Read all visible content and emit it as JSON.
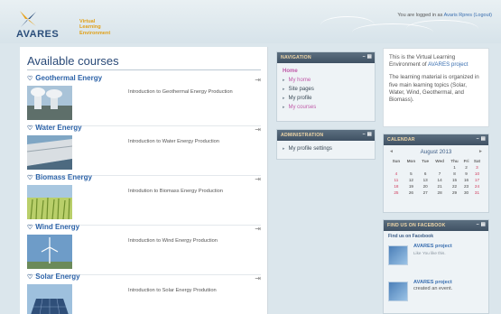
{
  "header": {
    "logo_word": "AVARES",
    "logo_tagline_1": "Virtual",
    "logo_tagline_2": "Learning",
    "logo_tagline_3": "Environment",
    "login_prefix": "You are logged in as",
    "login_user": "Avaris Rpres",
    "login_logout": "(Logout)"
  },
  "main": {
    "title": "Available courses",
    "courses": [
      {
        "name": "Geothermal Energy",
        "description": "Introduction to Geothermal Energy Production"
      },
      {
        "name": "Water Energy",
        "description": "Introduction to Water Energy Production"
      },
      {
        "name": "Biomass Energy",
        "description": "Introdution to Biomass Energy Production"
      },
      {
        "name": "Wind Energy",
        "description": "Introduction to Wind Energy Production"
      },
      {
        "name": "Solar Energy",
        "description": "Introduction to Solar Energy Produtiion"
      }
    ]
  },
  "navigation": {
    "title": "NAVIGATION",
    "home": "Home",
    "items": [
      "My home",
      "Site pages",
      "My profile",
      "My courses"
    ]
  },
  "administration": {
    "title": "ADMINISTRATION",
    "items": [
      "My profile settings"
    ]
  },
  "info": {
    "text_1_pre": "This is the Virtual Learning Environment of",
    "text_1_link": "AVARES project",
    "text_2": "The learning material is organized in five main learning topics (Solar, Water, Wind, Geothermal, and Biomass)."
  },
  "calendar": {
    "title": "CALENDAR",
    "month": "August 2013",
    "prev": "◄",
    "next": "►",
    "days": [
      "Sun",
      "Mon",
      "Tue",
      "Wed",
      "Thu",
      "Fri",
      "Sat"
    ],
    "weeks": [
      [
        "",
        "",
        "",
        "",
        "1",
        "2",
        "3"
      ],
      [
        "4",
        "5",
        "6",
        "7",
        "8",
        "9",
        "10"
      ],
      [
        "11",
        "12",
        "13",
        "14",
        "15",
        "16",
        "17"
      ],
      [
        "18",
        "19",
        "20",
        "21",
        "22",
        "23",
        "24"
      ],
      [
        "25",
        "26",
        "27",
        "28",
        "29",
        "30",
        "31"
      ]
    ]
  },
  "facebook": {
    "title": "FIND US ON FACEBOOK",
    "find_label": "Find us on Facebook",
    "page_name": "AVARES project",
    "like_label": "Like",
    "likes_text": "You like this.",
    "post_name": "AVARES project",
    "post_text": "created an event."
  },
  "colors": {
    "block_header": "#4a5d6f",
    "link": "#3a6fb0",
    "course_title": "#2d63a8",
    "nav_active": "#c05aa8"
  }
}
